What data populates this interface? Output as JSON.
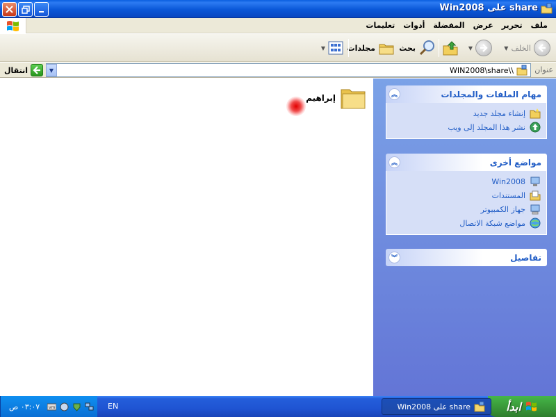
{
  "window": {
    "title": "share على Win2008"
  },
  "menu": {
    "items": [
      "ملف",
      "تحرير",
      "عرض",
      "المفضلة",
      "أدوات",
      "تعليمات"
    ]
  },
  "toolbar": {
    "back_label": "الخلف",
    "search_label": "بحث",
    "folders_label": "مجلدات"
  },
  "address": {
    "label": "عنوان",
    "value": "\\\\WIN2008\\share",
    "go_label": "انتقال"
  },
  "files": [
    {
      "name": "إبراهيم",
      "icon": "folder-icon"
    }
  ],
  "taskpane": {
    "file_tasks": {
      "title": "مهام الملفات والمجلدات",
      "links": [
        {
          "label": "إنشاء مجلد جديد",
          "icon": "new-folder-icon"
        },
        {
          "label": "نشر هذا المجلد إلى ويب",
          "icon": "publish-web-icon"
        }
      ]
    },
    "other_places": {
      "title": "مواضع أخرى",
      "links": [
        {
          "label": "Win2008",
          "icon": "computer-icon"
        },
        {
          "label": "المستندات",
          "icon": "documents-icon"
        },
        {
          "label": "جهاز الكمبيوتر",
          "icon": "my-computer-icon"
        },
        {
          "label": "مواضع شبكة الاتصال",
          "icon": "network-icon"
        }
      ]
    },
    "details": {
      "title": "تفاصيل"
    }
  },
  "taskbar": {
    "start_label": "ابدأ",
    "task_label": "share على Win2008",
    "language": "EN",
    "clock": "٠٣:٠٧ ص"
  },
  "colors": {
    "titlebar": "#0a57d8",
    "taskpane": "#7ba2e7",
    "link": "#215dc6",
    "start": "#3a9a3a"
  }
}
